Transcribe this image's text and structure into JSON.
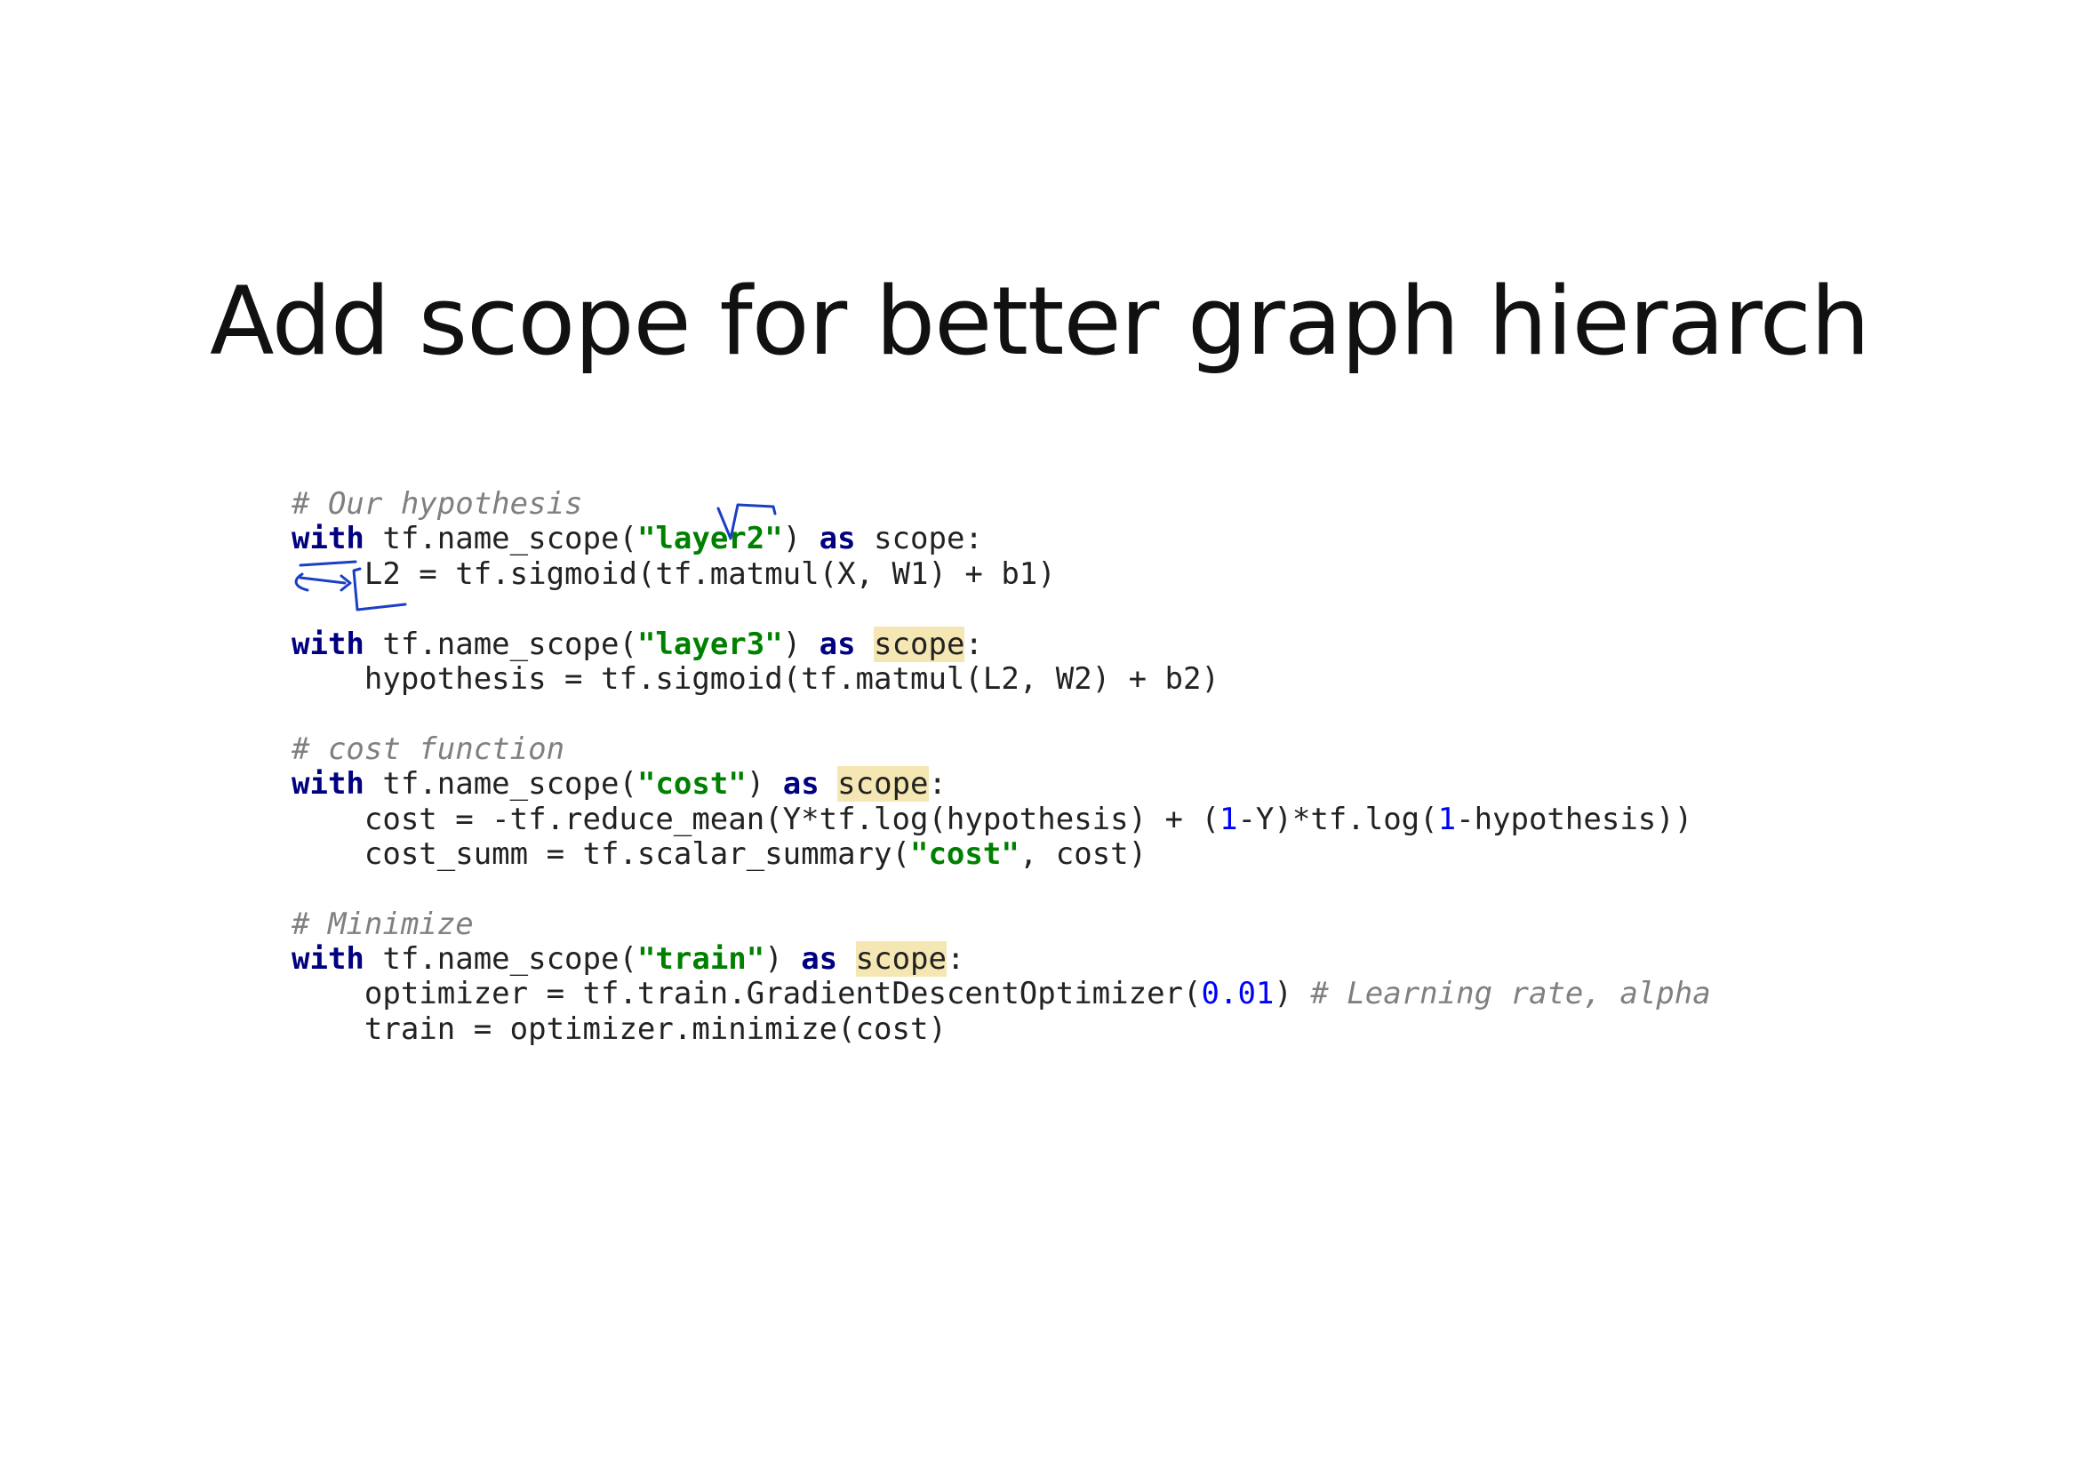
{
  "title": "Add scope for better graph hierarch",
  "code_lines": [
    [
      {
        "t": "# Our hypothesis",
        "c": "comment"
      }
    ],
    [
      {
        "t": "with",
        "c": "kw"
      },
      {
        "t": " tf.name_scope(",
        "c": ""
      },
      {
        "t": "\"layer2\"",
        "c": "str"
      },
      {
        "t": ") ",
        "c": ""
      },
      {
        "t": "as",
        "c": "kw"
      },
      {
        "t": " scope:",
        "c": ""
      }
    ],
    [
      {
        "t": "    L2 = tf.sigmoid(tf.matmul(X, W1) + b1)",
        "c": ""
      }
    ],
    [],
    [
      {
        "t": "with",
        "c": "kw"
      },
      {
        "t": " tf.name_scope(",
        "c": ""
      },
      {
        "t": "\"layer3\"",
        "c": "str"
      },
      {
        "t": ") ",
        "c": ""
      },
      {
        "t": "as",
        "c": "kw"
      },
      {
        "t": " ",
        "c": ""
      },
      {
        "t": "scope",
        "c": "hl"
      },
      {
        "t": ":",
        "c": ""
      }
    ],
    [
      {
        "t": "    hypothesis = tf.sigmoid(tf.matmul(L2, W2) + b2)",
        "c": ""
      }
    ],
    [],
    [
      {
        "t": "# cost function",
        "c": "comment"
      }
    ],
    [
      {
        "t": "with",
        "c": "kw"
      },
      {
        "t": " tf.name_scope(",
        "c": ""
      },
      {
        "t": "\"cost\"",
        "c": "str"
      },
      {
        "t": ") ",
        "c": ""
      },
      {
        "t": "as",
        "c": "kw"
      },
      {
        "t": " ",
        "c": ""
      },
      {
        "t": "scope",
        "c": "hl"
      },
      {
        "t": ":",
        "c": ""
      }
    ],
    [
      {
        "t": "    cost = -tf.reduce_mean(Y*tf.log(hypothesis) + (",
        "c": ""
      },
      {
        "t": "1",
        "c": "num"
      },
      {
        "t": "-Y)*tf.log(",
        "c": ""
      },
      {
        "t": "1",
        "c": "num"
      },
      {
        "t": "-hypothesis))",
        "c": ""
      }
    ],
    [
      {
        "t": "    cost_summ = tf.scalar_summary(",
        "c": ""
      },
      {
        "t": "\"cost\"",
        "c": "str"
      },
      {
        "t": ", cost)",
        "c": ""
      }
    ],
    [],
    [
      {
        "t": "# Minimize",
        "c": "comment"
      }
    ],
    [
      {
        "t": "with",
        "c": "kw"
      },
      {
        "t": " tf.name_scope(",
        "c": ""
      },
      {
        "t": "\"train\"",
        "c": "str"
      },
      {
        "t": ") ",
        "c": ""
      },
      {
        "t": "as",
        "c": "kw"
      },
      {
        "t": " ",
        "c": ""
      },
      {
        "t": "scope",
        "c": "hl"
      },
      {
        "t": ":",
        "c": ""
      }
    ],
    [
      {
        "t": "    optimizer = tf.train.GradientDescentOptimizer(",
        "c": ""
      },
      {
        "t": "0.01",
        "c": "num"
      },
      {
        "t": ") ",
        "c": ""
      },
      {
        "t": "# Learning rate, alpha",
        "c": "comment"
      }
    ],
    [
      {
        "t": "    train = optimizer.minimize(cost)",
        "c": ""
      }
    ]
  ],
  "colors": {
    "keyword": "#000080",
    "string": "#008000",
    "comment": "#808080",
    "number": "#0000ff",
    "highlight": "#f5e7b3",
    "ink": "#1a3fc4"
  }
}
